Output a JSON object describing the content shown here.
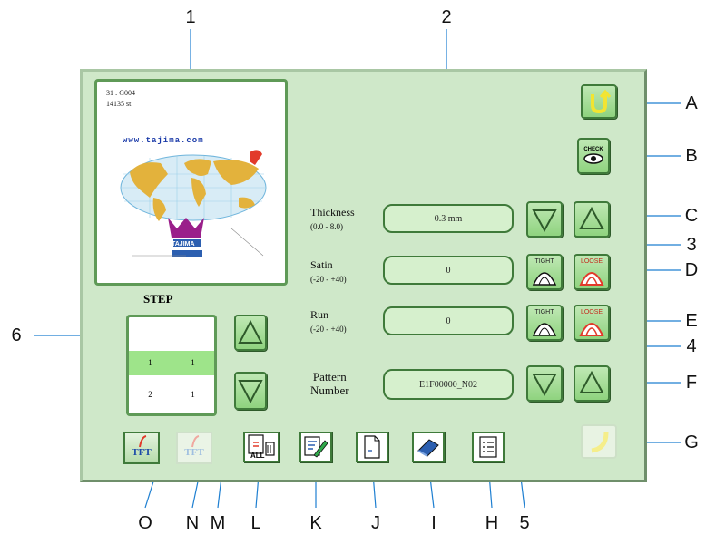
{
  "callouts": {
    "top": [
      "1",
      "2"
    ],
    "right": [
      "A",
      "B",
      "C",
      "3",
      "D",
      "E",
      "4",
      "F",
      "G"
    ],
    "left": [
      "6"
    ],
    "bottom": [
      "O",
      "N",
      "M",
      "L",
      "K",
      "J",
      "I",
      "H",
      "5"
    ]
  },
  "preview": {
    "line1": "31 : G004",
    "line2": "14135 st.",
    "url_text": "www.tajima.com",
    "logo_text": "TAJIMA"
  },
  "thickness": {
    "label": "Thickness",
    "range": "(0.0 - 8.0)",
    "value": "0.3 mm"
  },
  "satin": {
    "label": "Satin",
    "range": "(-20 - +40)",
    "value": "0"
  },
  "run": {
    "label": "Run",
    "range": "(-20 - +40)",
    "value": "0"
  },
  "pattern": {
    "label_line1": "Pattern",
    "label_line2": "Number",
    "value": "E1F00000_N02"
  },
  "step": {
    "title": "STEP",
    "rows": [
      {
        "a": "",
        "b": ""
      },
      {
        "a": "1",
        "b": "1"
      },
      {
        "a": "2",
        "b": "1"
      }
    ]
  },
  "buttons": {
    "check_label": "CHECK",
    "tight_label": "TIGHT",
    "loose_label": "LOOSE",
    "all_label": "ALL",
    "tft_label": "TFT"
  },
  "colors": {
    "panel": "#cfe8c9",
    "button": "#8fd37f",
    "border": "#3f7a3a",
    "accent_red": "#e23a2a",
    "accent_yellow": "#f2e431"
  }
}
